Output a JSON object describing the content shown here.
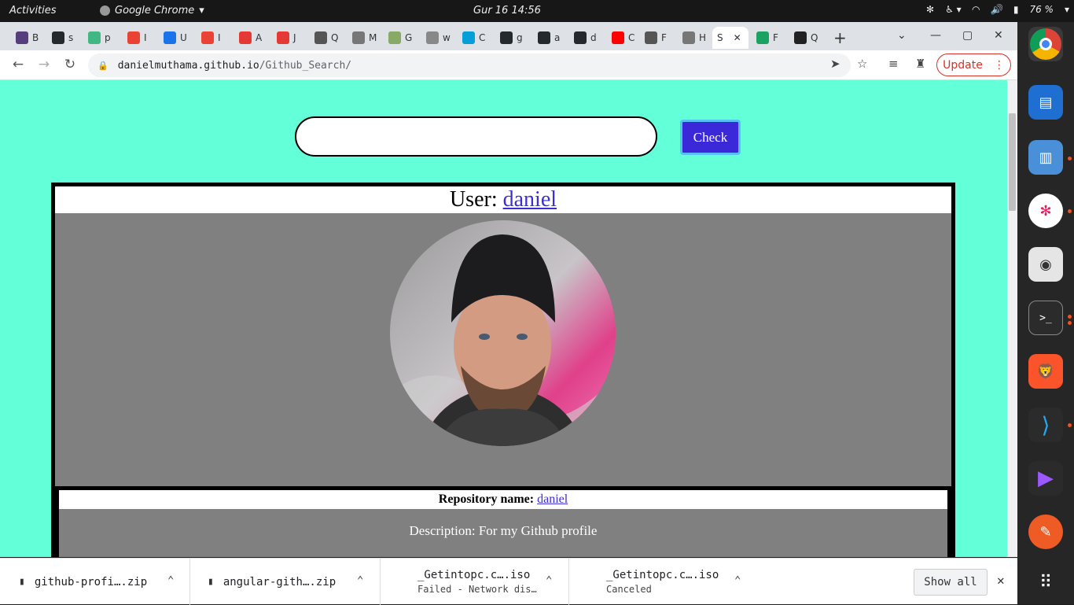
{
  "system_bar": {
    "activities": "Activities",
    "app_name": "Google Chrome",
    "clock": "Gur 16 14:56",
    "battery": "76 %"
  },
  "tabs": [
    {
      "label": "B",
      "icon": "bootstrap-icon",
      "color": "#563d7c"
    },
    {
      "label": "s",
      "icon": "github-icon",
      "color": "#24292e"
    },
    {
      "label": "p",
      "icon": "vue-icon",
      "color": "#41b883"
    },
    {
      "label": "I",
      "icon": "gmail-icon",
      "color": "#ea4335"
    },
    {
      "label": "U",
      "icon": "u-icon",
      "color": "#1a73e8"
    },
    {
      "label": "I",
      "icon": "gmail-icon",
      "color": "#ea4335"
    },
    {
      "label": "A",
      "icon": "media-icon",
      "color": "#e53935"
    },
    {
      "label": "J",
      "icon": "media-icon",
      "color": "#e53935"
    },
    {
      "label": "Q",
      "icon": "code-icon",
      "color": "#555"
    },
    {
      "label": "M",
      "icon": "globe-icon",
      "color": "#777"
    },
    {
      "label": "G",
      "icon": "tree-icon",
      "color": "#8a6"
    },
    {
      "label": "w",
      "icon": "play-icon",
      "color": "#888"
    },
    {
      "label": "C",
      "icon": "cisco-icon",
      "color": "#049fd9"
    },
    {
      "label": "g",
      "icon": "github-icon",
      "color": "#24292e"
    },
    {
      "label": "a",
      "icon": "github-icon",
      "color": "#24292e"
    },
    {
      "label": "d",
      "icon": "github-icon",
      "color": "#24292e"
    },
    {
      "label": "C",
      "icon": "youtube-icon",
      "color": "#ff0000"
    },
    {
      "label": "F",
      "icon": "audio-icon",
      "color": "#555"
    },
    {
      "label": "H",
      "icon": "globe-icon",
      "color": "#777"
    },
    {
      "label": "S",
      "icon": "none",
      "color": "#fff"
    },
    {
      "label": "F",
      "icon": "w-icon",
      "color": "#1aa260"
    },
    {
      "label": "Q",
      "icon": "angular-icon",
      "color": "#222"
    }
  ],
  "address_bar": {
    "domain": "danielmuthama.github.io",
    "path": "/Github_Search/"
  },
  "update_button": "Update",
  "page": {
    "search_value": "",
    "check_label": "Check",
    "user_prefix": "User: ",
    "user_name": "daniel",
    "repo_label": "Repository name: ",
    "repo_name": "daniel",
    "description": "Description: For my Github profile"
  },
  "downloads": [
    {
      "name": "github-profi….zip",
      "status": ""
    },
    {
      "name": "angular-gith….zip",
      "status": ""
    },
    {
      "name": "_Getintopc.c….iso",
      "status": "Failed - Network dis…"
    },
    {
      "name": "_Getintopc.c….iso",
      "status": "Canceled"
    }
  ],
  "show_all": "Show all",
  "colors": {
    "page_bg": "#63ffd8",
    "button_bg": "#3b29d9",
    "panel_gray": "#808080"
  }
}
